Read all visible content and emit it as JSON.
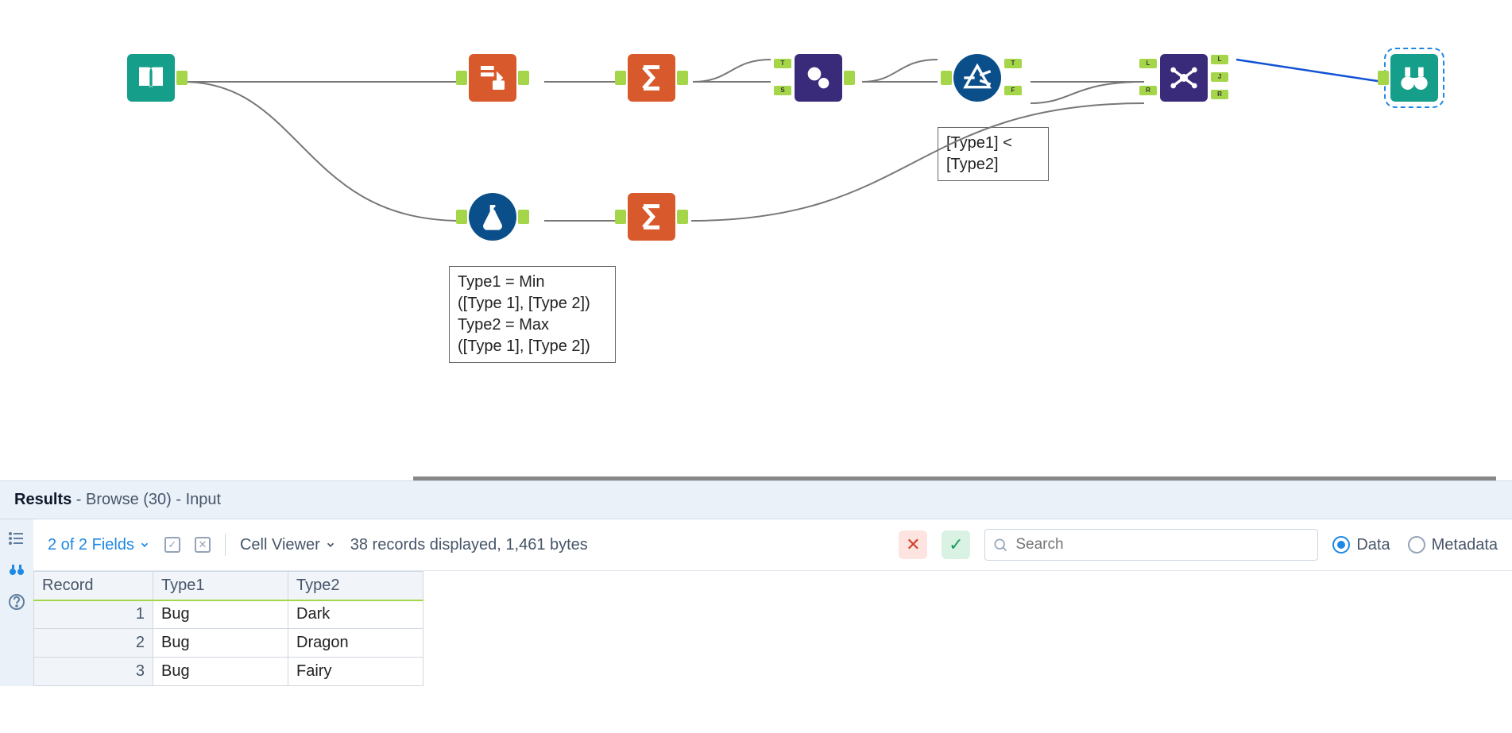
{
  "annotations": {
    "formula": "Type1 = Min\n([Type 1], [Type 2])\nType2 = Max\n([Type 1], [Type 2])",
    "filter": "[Type1] <\n[Type2]"
  },
  "results": {
    "header_bold": "Results",
    "header_rest": " - Browse (30) - Input",
    "fields_label": "2 of 2 Fields",
    "cell_viewer": "Cell Viewer",
    "summary": "38 records displayed, 1,461 bytes",
    "search_placeholder": "Search",
    "radio_data": "Data",
    "radio_metadata": "Metadata"
  },
  "table": {
    "cols": [
      "Record",
      "Type1",
      "Type2"
    ],
    "rows": [
      {
        "rec": "1",
        "c1": "Bug",
        "c2": "Dark"
      },
      {
        "rec": "2",
        "c1": "Bug",
        "c2": "Dragon"
      },
      {
        "rec": "3",
        "c1": "Bug",
        "c2": "Fairy"
      }
    ]
  }
}
